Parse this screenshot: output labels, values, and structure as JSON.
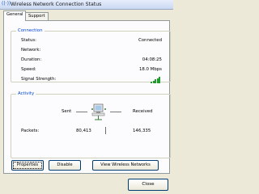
{
  "window": {
    "title": "Wireless Network Connection Status"
  },
  "tabs": [
    {
      "label": "General",
      "active": true
    },
    {
      "label": "Support",
      "active": false
    }
  ],
  "connection": {
    "title": "Connection",
    "rows": [
      {
        "label": "Status:",
        "value": "Connected"
      },
      {
        "label": "Network:",
        "value": ""
      },
      {
        "label": "Duration:",
        "value": "04:08:25"
      },
      {
        "label": "Speed:",
        "value": "18.0 Mbps"
      },
      {
        "label": "Signal Strength:",
        "icon": "signal-strength-icon",
        "bars_lit": 5,
        "bars_total": 5
      }
    ]
  },
  "activity": {
    "title": "Activity",
    "sent_label": "Sent",
    "received_label": "Received",
    "packets_label": "Packets:",
    "packets_sent": "80,413",
    "packets_received": "146,335",
    "icon": "network-computer-icon"
  },
  "buttons": {
    "properties": "Properties",
    "disable": "Disable",
    "view_networks": "View Wireless Networks",
    "close": "Close"
  },
  "colors": {
    "group_title": "#0046d5",
    "signal": "#1e9b2c",
    "window_bg": "#ece9d8"
  }
}
